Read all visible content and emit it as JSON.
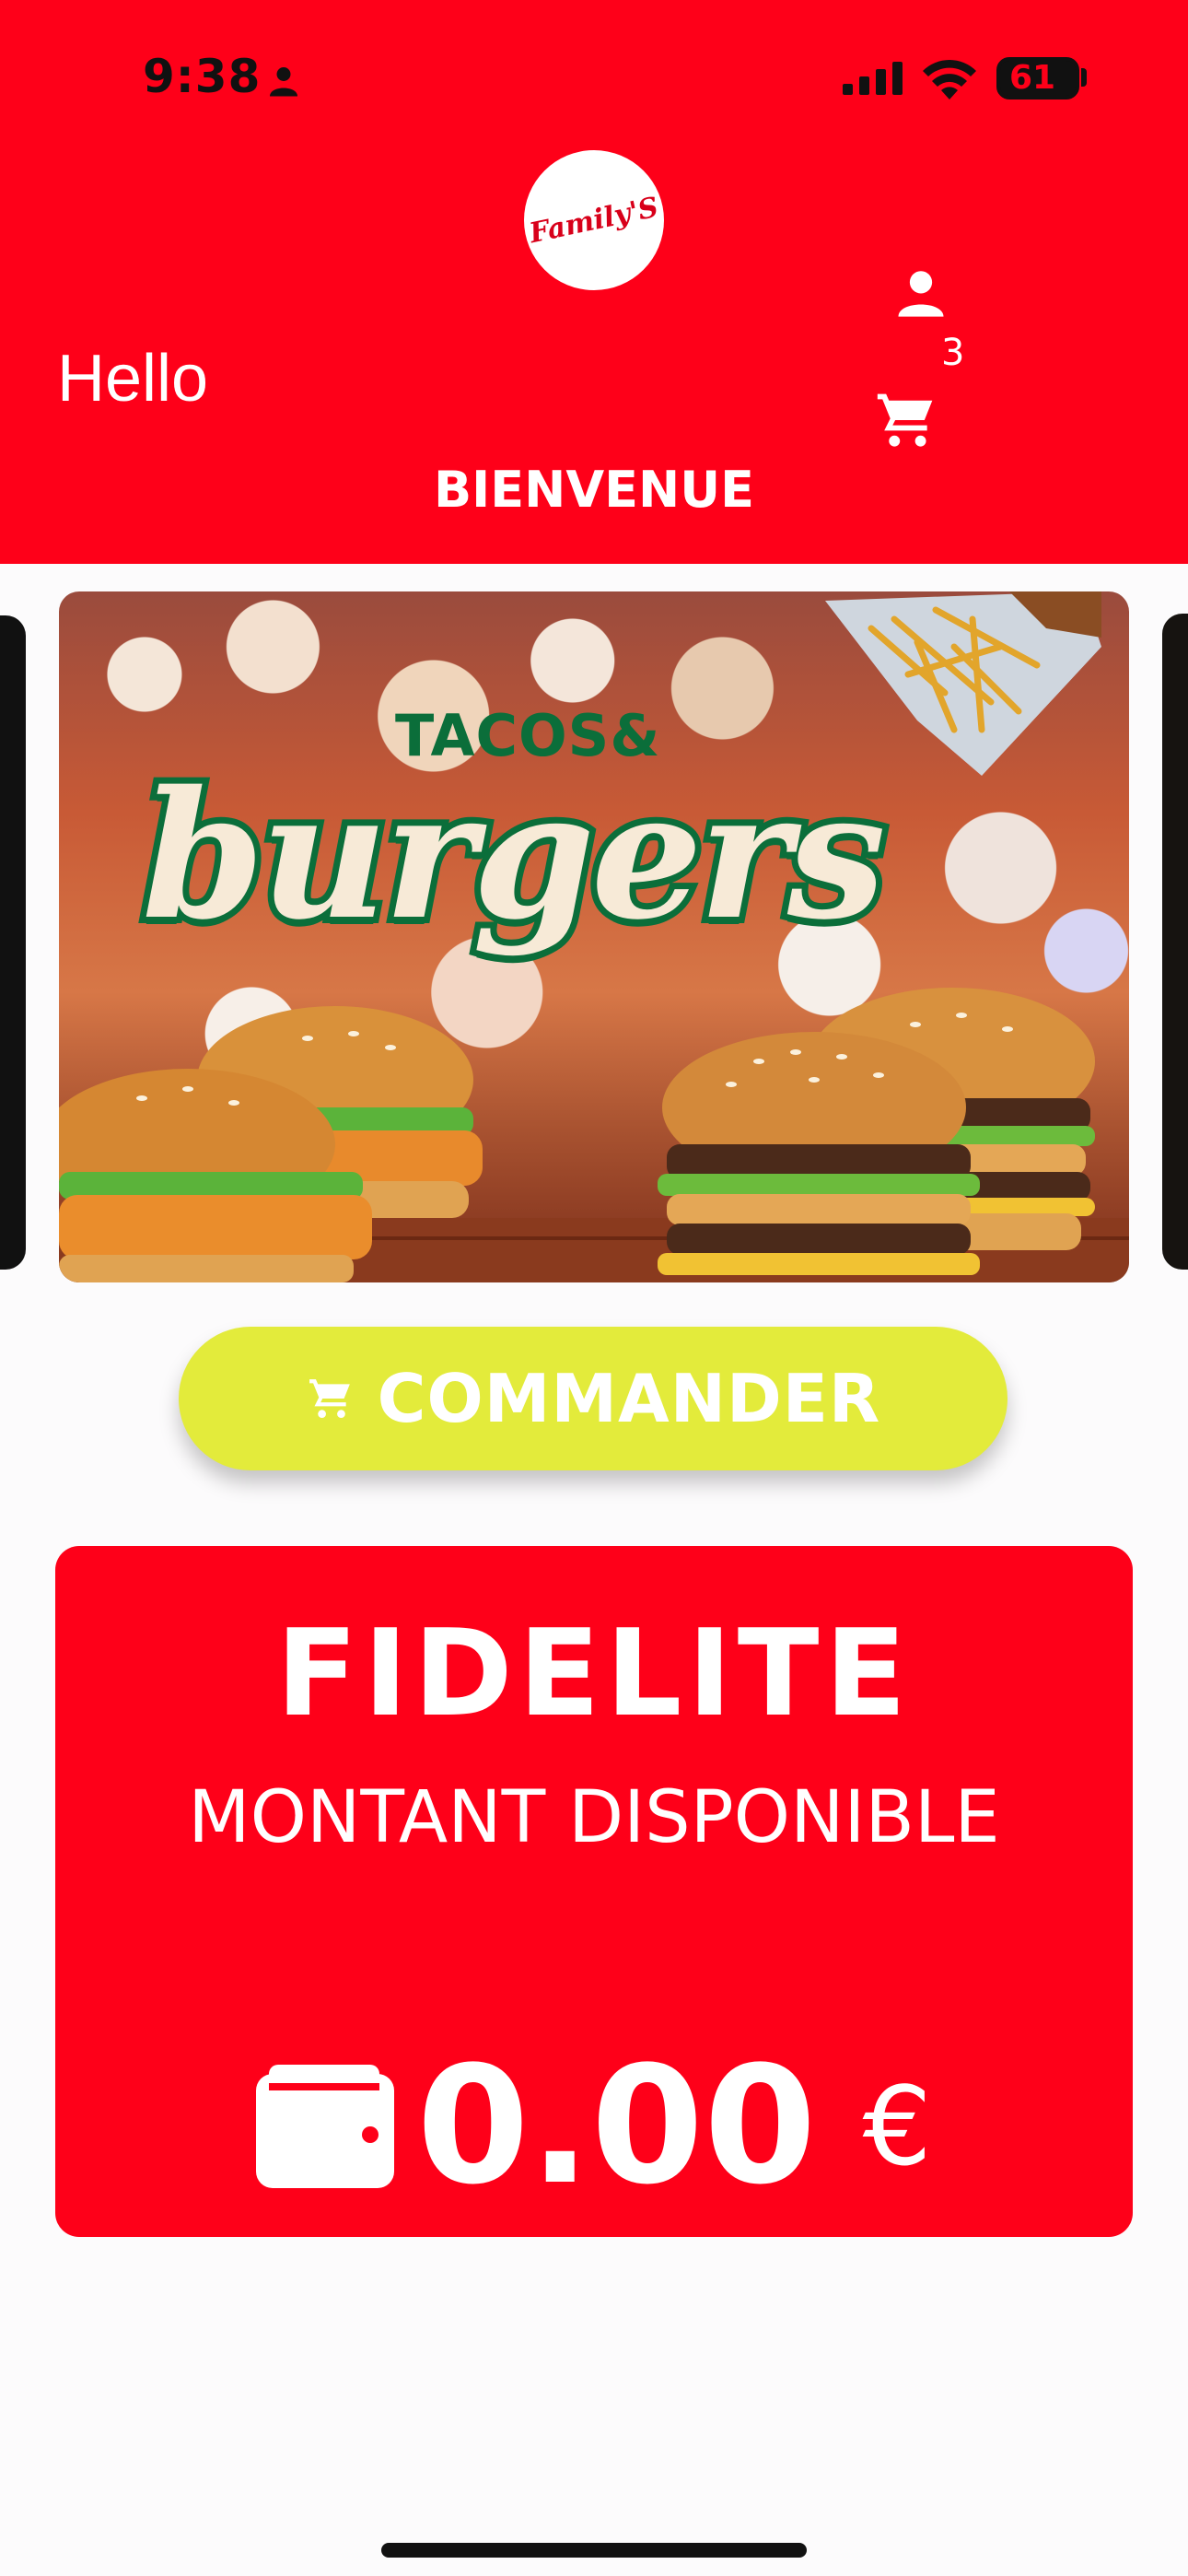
{
  "status_bar": {
    "time": "9:38",
    "battery": "61"
  },
  "header": {
    "logo_text": "Family'S",
    "greeting": "Hello",
    "cart_count": "3",
    "welcome": "BIENVENUE"
  },
  "banner": {
    "tagline": "TACOS&",
    "title": "burgers"
  },
  "order_button": {
    "label": "COMMANDER",
    "icon": "cart-icon"
  },
  "loyalty": {
    "title": "FIDELITE",
    "subtitle": "MONTANT DISPONIBLE",
    "amount": "0.00",
    "currency": "€",
    "icon": "wallet-icon"
  },
  "colors": {
    "brand_red": "#fe0019",
    "accent_yellow": "#e3eb3b",
    "banner_green": "#0b6e3a"
  }
}
